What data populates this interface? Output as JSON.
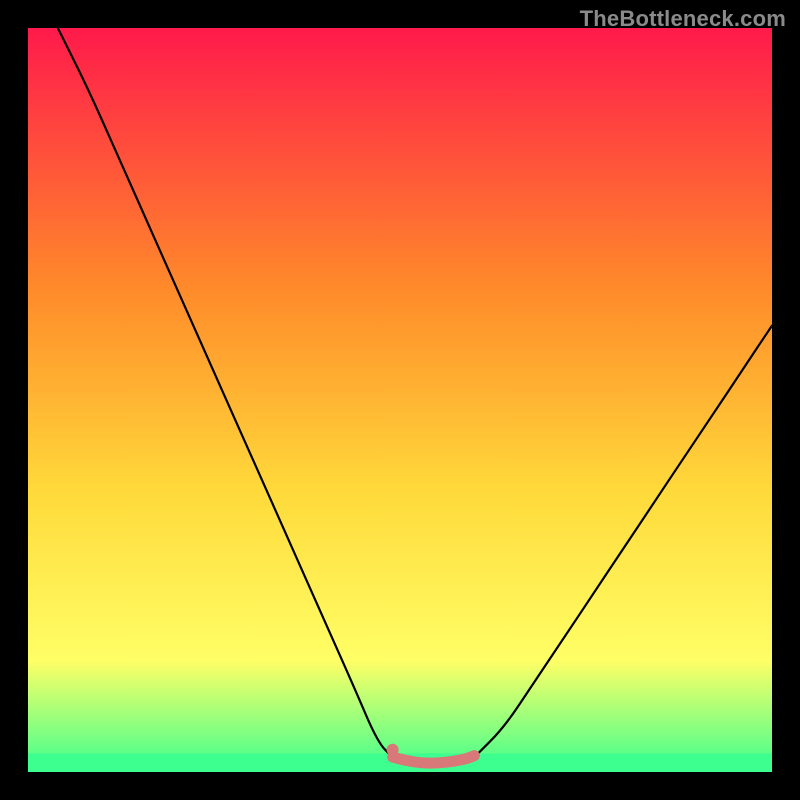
{
  "watermark": "TheBottleneck.com",
  "chart_data": {
    "type": "line",
    "title": "",
    "xlabel": "",
    "ylabel": "",
    "xlim": [
      0,
      100
    ],
    "ylim": [
      0,
      100
    ],
    "grid": false,
    "legend": false,
    "background_gradient": [
      "#ff1a4b",
      "#ff8a2a",
      "#ffd93a",
      "#ffff66",
      "#3dff8f"
    ],
    "series": [
      {
        "name": "left-curve",
        "color": "#000000",
        "x": [
          4,
          8,
          12,
          16,
          20,
          24,
          28,
          32,
          36,
          40,
          44,
          47,
          49
        ],
        "y": [
          100,
          92,
          83,
          74,
          65,
          56,
          47,
          38,
          29,
          20,
          11,
          4,
          2
        ]
      },
      {
        "name": "right-curve",
        "color": "#000000",
        "x": [
          60,
          64,
          68,
          72,
          76,
          80,
          84,
          88,
          92,
          96,
          100
        ],
        "y": [
          2,
          6,
          12,
          18,
          24,
          30,
          36,
          42,
          48,
          54,
          60
        ]
      },
      {
        "name": "valley-floor",
        "color": "#d87878",
        "x": [
          49,
          51,
          53,
          55,
          57,
          59,
          60
        ],
        "y": [
          2,
          1.5,
          1.2,
          1.2,
          1.4,
          1.8,
          2.2
        ]
      }
    ],
    "markers": [
      {
        "name": "valley-dot",
        "x": 49,
        "y": 3,
        "color": "#d87878",
        "r": 6
      }
    ],
    "bottom_strip": {
      "color": "#3dff8f",
      "y_from": 0,
      "y_to": 2.5
    }
  }
}
